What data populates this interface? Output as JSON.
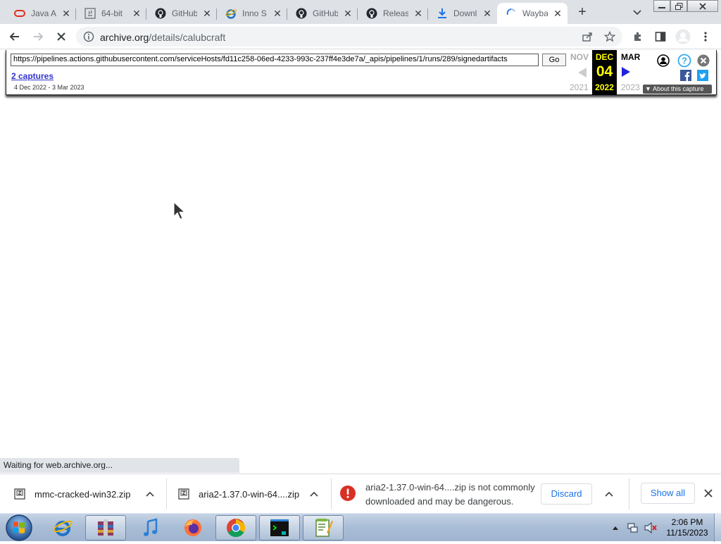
{
  "tabs": [
    {
      "label": "Java Ar",
      "icon": "oracle-icon"
    },
    {
      "label": "64-bit",
      "icon": "java-icon"
    },
    {
      "label": "GitHub",
      "icon": "github-icon"
    },
    {
      "label": "Inno S",
      "icon": "ie-icon"
    },
    {
      "label": "GitHub",
      "icon": "github-icon"
    },
    {
      "label": "Releas",
      "icon": "github-icon"
    },
    {
      "label": "Downl",
      "icon": "download-icon"
    },
    {
      "label": "Wayba",
      "icon": "loading-spinner-icon"
    }
  ],
  "toolbar": {
    "url_host": "archive.org",
    "url_path": "/details/calubcraft"
  },
  "wayback": {
    "url": "https://pipelines.actions.githubusercontent.com/serviceHosts/fd11c258-06ed-4233-993c-237ff4e3de7a/_apis/pipelines/1/runs/289/signedartifacts",
    "go": "Go",
    "captures": "2 captures",
    "range": "4 Dec 2022 - 3 Mar 2023",
    "prev_month": "NOV",
    "prev_year": "2021",
    "cur_month": "DEC",
    "cur_day": "04",
    "cur_year": "2022",
    "next_month": "MAR",
    "next_year": "2023",
    "about": "About this capture"
  },
  "status": "Waiting for web.archive.org...",
  "downloads": {
    "items": [
      {
        "name": "mmc-cracked-win32.zip"
      },
      {
        "name": "aria2-1.37.0-win-64....zip"
      }
    ],
    "warning": "aria2-1.37.0-win-64....zip is not commonly downloaded and may be dangerous.",
    "discard": "Discard",
    "show_all": "Show all"
  },
  "clock": {
    "time": "2:06 PM",
    "date": "11/15/2023"
  }
}
